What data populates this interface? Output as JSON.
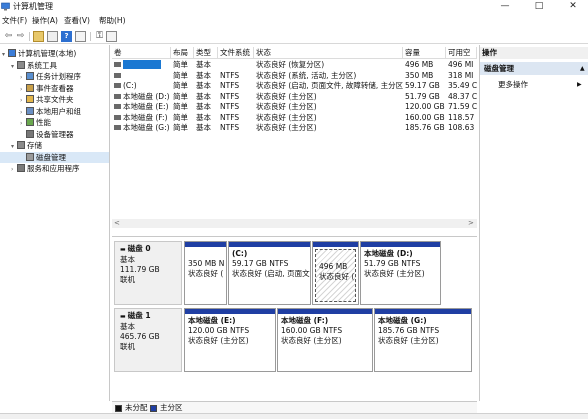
{
  "window": {
    "title": "计算机管理",
    "min": "—",
    "max": "□",
    "close": "✕"
  },
  "menu": [
    "文件(F)",
    "操作(A)",
    "查看(V)",
    "帮助(H)"
  ],
  "tree": [
    {
      "label": "计算机管理(本地)",
      "icon": "computer-icon",
      "level": 0,
      "tw": "▾"
    },
    {
      "label": "系统工具",
      "icon": "tools-icon",
      "level": 1,
      "tw": "▾"
    },
    {
      "label": "任务计划程序",
      "icon": "clock-icon",
      "level": 2,
      "tw": "›"
    },
    {
      "label": "事件查看器",
      "icon": "event-icon",
      "level": 2,
      "tw": "›"
    },
    {
      "label": "共享文件夹",
      "icon": "folder-icon",
      "level": 2,
      "tw": "›"
    },
    {
      "label": "本地用户和组",
      "icon": "users-icon",
      "level": 2,
      "tw": "›"
    },
    {
      "label": "性能",
      "icon": "performance-icon",
      "level": 2,
      "tw": "›"
    },
    {
      "label": "设备管理器",
      "icon": "device-icon",
      "level": 2,
      "tw": ""
    },
    {
      "label": "存储",
      "icon": "storage-icon",
      "level": 1,
      "tw": "▾"
    },
    {
      "label": "磁盘管理",
      "icon": "disk-icon",
      "level": 2,
      "tw": "",
      "selected": true
    },
    {
      "label": "服务和应用程序",
      "icon": "services-icon",
      "level": 1,
      "tw": "›"
    }
  ],
  "volumes": {
    "headers": [
      "卷",
      "布局",
      "类型",
      "文件系统",
      "状态",
      "容量",
      "可用空"
    ],
    "rows": [
      {
        "name": "",
        "layout": "简单",
        "type": "基本",
        "fs": "",
        "status": "状态良好 (恢复分区)",
        "capacity": "496 MB",
        "free": "496 MI",
        "selected": true
      },
      {
        "name": "",
        "layout": "简单",
        "type": "基本",
        "fs": "NTFS",
        "status": "状态良好 (系统, 活动, 主分区)",
        "capacity": "350 MB",
        "free": "318 MI"
      },
      {
        "name": "(C:)",
        "layout": "简单",
        "type": "基本",
        "fs": "NTFS",
        "status": "状态良好 (启动, 页面文件, 故障转储, 主分区)",
        "capacity": "59.17 GB",
        "free": "35.49 C"
      },
      {
        "name": "本地磁盘 (D:)",
        "layout": "简单",
        "type": "基本",
        "fs": "NTFS",
        "status": "状态良好 (主分区)",
        "capacity": "51.79 GB",
        "free": "48.37 C"
      },
      {
        "name": "本地磁盘 (E:)",
        "layout": "简单",
        "type": "基本",
        "fs": "NTFS",
        "status": "状态良好 (主分区)",
        "capacity": "120.00 GB",
        "free": "71.59 C"
      },
      {
        "name": "本地磁盘 (F:)",
        "layout": "简单",
        "type": "基本",
        "fs": "NTFS",
        "status": "状态良好 (主分区)",
        "capacity": "160.00 GB",
        "free": "118.57"
      },
      {
        "name": "本地磁盘 (G:)",
        "layout": "简单",
        "type": "基本",
        "fs": "NTFS",
        "status": "状态良好 (主分区)",
        "capacity": "185.76 GB",
        "free": "108.63"
      }
    ]
  },
  "disks": [
    {
      "name": "磁盘 0",
      "type": "基本",
      "size": "111.79 GB",
      "state": "联机",
      "partitions": [
        {
          "title": "",
          "size": "350 MB N",
          "status": "状态良好 (",
          "hatched": false
        },
        {
          "title": "(C:)",
          "size": "59.17 GB NTFS",
          "status": "状态良好 (启动, 页面文",
          "hatched": false
        },
        {
          "title": "",
          "size": "496 MB",
          "status": "状态良好 (",
          "hatched": true
        },
        {
          "title": "本地磁盘 (D:)",
          "size": "51.79 GB NTFS",
          "status": "状态良好 (主分区)",
          "hatched": false
        }
      ]
    },
    {
      "name": "磁盘 1",
      "type": "基本",
      "size": "465.76 GB",
      "state": "联机",
      "partitions": [
        {
          "title": "本地磁盘 (E:)",
          "size": "120.00 GB NTFS",
          "status": "状态良好 (主分区)",
          "hatched": false
        },
        {
          "title": "本地磁盘 (F:)",
          "size": "160.00 GB NTFS",
          "status": "状态良好 (主分区)",
          "hatched": false
        },
        {
          "title": "本地磁盘 (G:)",
          "size": "185.76 GB NTFS",
          "status": "状态良好 (主分区)",
          "hatched": false
        }
      ]
    }
  ],
  "actions": {
    "header": "操作",
    "section": "磁盘管理",
    "section_arrow": "▲",
    "more": "更多操作",
    "more_arrow": "▶"
  },
  "legend": [
    {
      "label": "未分配",
      "color": "#111111"
    },
    {
      "label": "主分区",
      "color": "#1f3ea3"
    }
  ],
  "scroll": {
    "left": "<",
    "right": ">"
  },
  "colors": {
    "accent": "#1b78d2",
    "primary_partition": "#1f3ea3",
    "unallocated": "#111111",
    "selection": "#d9e8f7"
  }
}
